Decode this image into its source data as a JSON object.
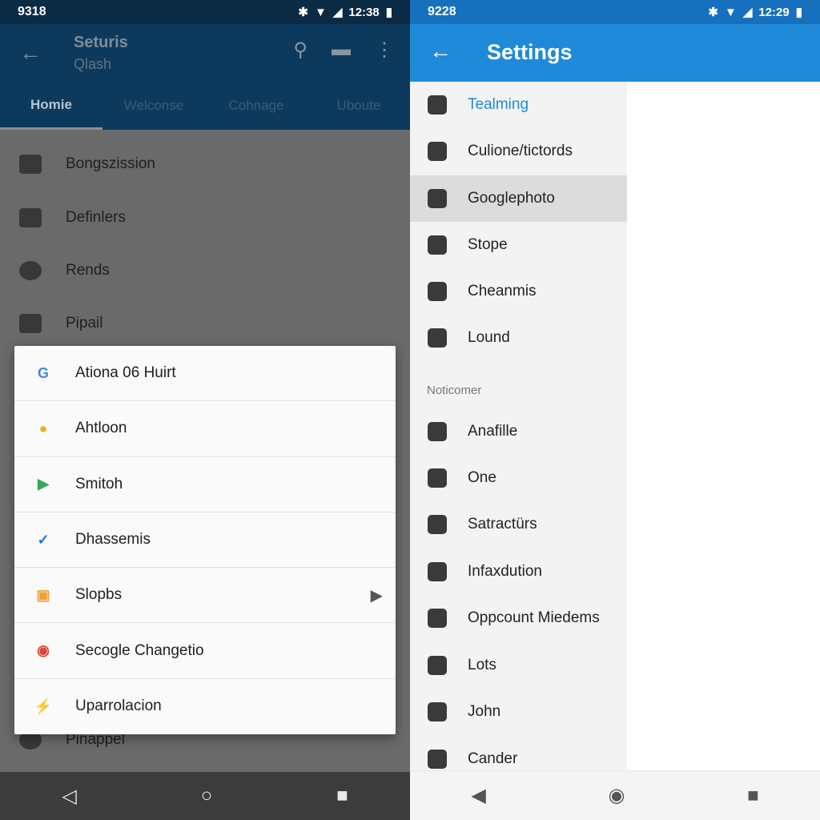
{
  "left": {
    "status": {
      "time": "9318",
      "right": "12:38"
    },
    "appbar": {
      "title": "Seturis",
      "subtitle": "Qlash"
    },
    "tabs": [
      "Homie",
      "Welconse",
      "Cohnage",
      "Uboute"
    ],
    "list": [
      "Bongszission",
      "Definlers",
      "Rends",
      "Pipail",
      "Pinappel"
    ],
    "dialog": [
      {
        "label": "Ationa 06 Huirt",
        "icon": "google-icon",
        "color": "#4285f4",
        "glyph": "G"
      },
      {
        "label": "Ahtloon",
        "icon": "chrome-icon",
        "color": "#e8b520",
        "glyph": "●"
      },
      {
        "label": "Smitoh",
        "icon": "play-store-icon",
        "color": "#34a853",
        "glyph": "▶"
      },
      {
        "label": "Dhassemis",
        "icon": "check-circle-icon",
        "color": "#1a73e8",
        "glyph": "✓"
      },
      {
        "label": "Slopbs",
        "icon": "app-icon",
        "color": "#f0a030",
        "glyph": "▣",
        "submenu": true
      },
      {
        "label": "Secogle Changetio",
        "icon": "chrome-icon",
        "color": "#db4437",
        "glyph": "◉"
      },
      {
        "label": "Uparrolacion",
        "icon": "bolt-icon",
        "color": "#555555",
        "glyph": "⚡"
      }
    ]
  },
  "right": {
    "status": {
      "time": "9228",
      "right": "12:29"
    },
    "appbar": {
      "title": "Settings"
    },
    "items": [
      "Tealming",
      "Culione/tictords",
      "Googlephoto",
      "Stope",
      "Cheanmis",
      "Lound"
    ],
    "section": "Noticomer",
    "items2": [
      "Anafille",
      "One",
      "Satractürs",
      "Infaxdution",
      "Oppcount Miedems",
      "Lots",
      "John",
      "Cander"
    ],
    "accent": "#1e8ad8"
  }
}
